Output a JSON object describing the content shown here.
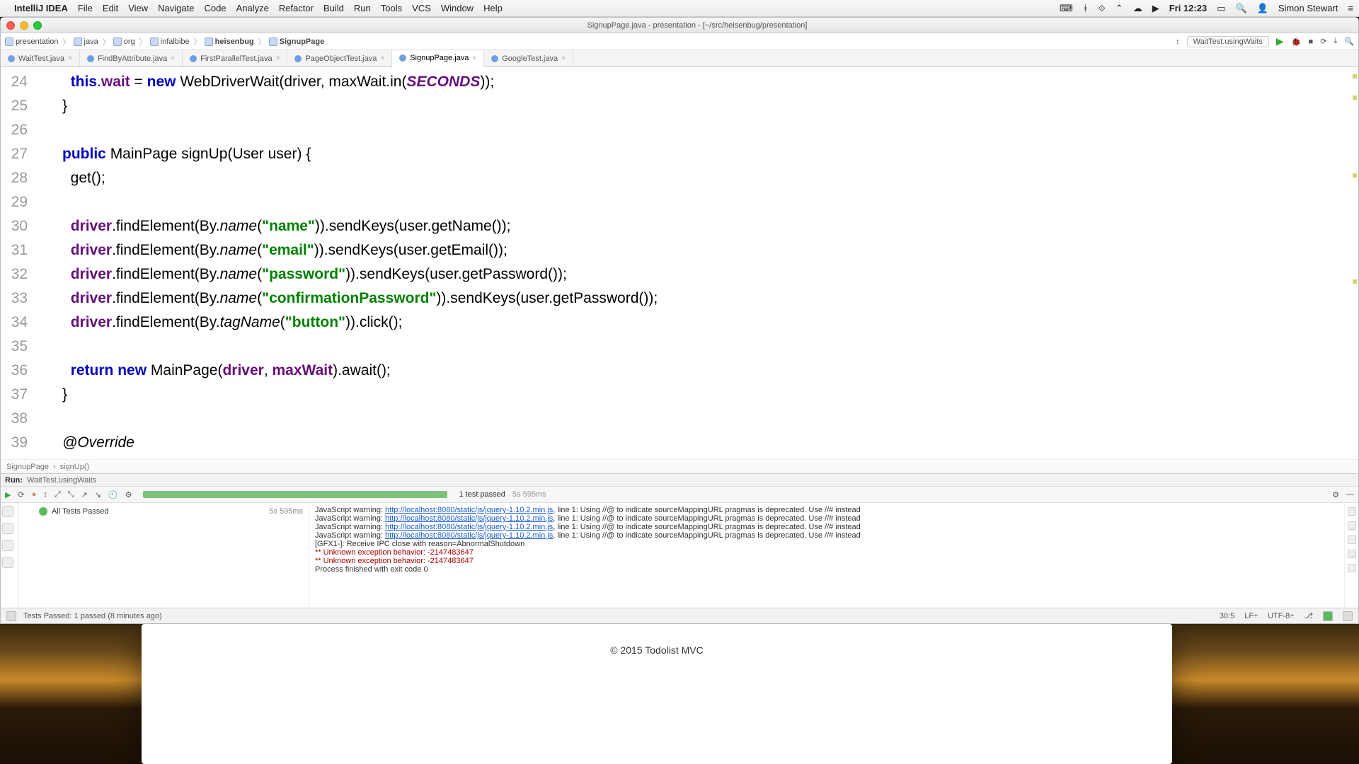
{
  "menubar": {
    "app": "IntelliJ IDEA",
    "items": [
      "File",
      "Edit",
      "View",
      "Navigate",
      "Code",
      "Analyze",
      "Refactor",
      "Build",
      "Run",
      "Tools",
      "VCS",
      "Window",
      "Help"
    ],
    "clock": "Fri 12:23",
    "user": "Simon Stewart"
  },
  "titlebar": {
    "title": "SignupPage.java - presentation - [~/src/heisenbug/presentation]"
  },
  "breadcrumbs": [
    "presentation",
    "java",
    "org",
    "infalbibe",
    "heisenbug",
    "SignupPage"
  ],
  "run_config": "WaitTest.usingWaits",
  "tabs": [
    {
      "label": "WaitTest.java",
      "active": false
    },
    {
      "label": "FindByAttribute.java",
      "active": false
    },
    {
      "label": "FirstParallelTest.java",
      "active": false
    },
    {
      "label": "PageObjectTest.java",
      "active": false
    },
    {
      "label": "SignupPage.java",
      "active": true
    },
    {
      "label": "GoogleTest.java",
      "active": false
    }
  ],
  "editor": {
    "first_line_no": 24,
    "lines": [
      {
        "n": 24,
        "indent": 3,
        "tokens": [
          {
            "t": "kw",
            "v": "this"
          },
          {
            "t": "p",
            "v": "."
          },
          {
            "t": "field",
            "v": "wait"
          },
          {
            "t": "p",
            "v": " = "
          },
          {
            "t": "kw",
            "v": "new"
          },
          {
            "t": "p",
            "v": " WebDriverWait("
          },
          {
            "t": "ident",
            "v": "driver"
          },
          {
            "t": "p",
            "v": ", "
          },
          {
            "t": "ident",
            "v": "maxWait"
          },
          {
            "t": "p",
            "v": ".in("
          },
          {
            "t": "const",
            "v": "SECONDS"
          },
          {
            "t": "p",
            "v": "));"
          }
        ]
      },
      {
        "n": 25,
        "indent": 2,
        "tokens": [
          {
            "t": "p",
            "v": "}"
          }
        ]
      },
      {
        "n": 26,
        "indent": 0,
        "tokens": []
      },
      {
        "n": 27,
        "indent": 2,
        "tokens": [
          {
            "t": "kw",
            "v": "public"
          },
          {
            "t": "p",
            "v": " MainPage signUp(User user) {"
          }
        ]
      },
      {
        "n": 28,
        "indent": 3,
        "tokens": [
          {
            "t": "p",
            "v": "get();"
          }
        ]
      },
      {
        "n": 29,
        "indent": 0,
        "tokens": []
      },
      {
        "n": 30,
        "indent": 3,
        "tokens": [
          {
            "t": "field",
            "v": "driver"
          },
          {
            "t": "p",
            "v": ".findElement(By."
          },
          {
            "t": "mname",
            "v": "name"
          },
          {
            "t": "p",
            "v": "("
          },
          {
            "t": "str",
            "v": "\"name\""
          },
          {
            "t": "p",
            "v": ")).sendKeys(user.getName());"
          }
        ]
      },
      {
        "n": 31,
        "indent": 3,
        "tokens": [
          {
            "t": "field",
            "v": "driver"
          },
          {
            "t": "p",
            "v": ".findElement(By."
          },
          {
            "t": "mname",
            "v": "name"
          },
          {
            "t": "p",
            "v": "("
          },
          {
            "t": "str",
            "v": "\"email\""
          },
          {
            "t": "p",
            "v": ")).sendKeys(user.getEmail());"
          }
        ]
      },
      {
        "n": 32,
        "indent": 3,
        "tokens": [
          {
            "t": "field",
            "v": "driver"
          },
          {
            "t": "p",
            "v": ".findElement(By."
          },
          {
            "t": "mname",
            "v": "name"
          },
          {
            "t": "p",
            "v": "("
          },
          {
            "t": "str",
            "v": "\"password\""
          },
          {
            "t": "p",
            "v": ")).sendKeys(user.getPassword());"
          }
        ]
      },
      {
        "n": 33,
        "indent": 3,
        "tokens": [
          {
            "t": "field",
            "v": "driver"
          },
          {
            "t": "p",
            "v": ".findElement(By."
          },
          {
            "t": "mname",
            "v": "name"
          },
          {
            "t": "p",
            "v": "("
          },
          {
            "t": "str",
            "v": "\"confirmationPassword\""
          },
          {
            "t": "p",
            "v": ")).sendKeys(user.getPassword());"
          }
        ]
      },
      {
        "n": 34,
        "indent": 3,
        "tokens": [
          {
            "t": "field",
            "v": "driver"
          },
          {
            "t": "p",
            "v": ".findElement(By."
          },
          {
            "t": "mname",
            "v": "tagName"
          },
          {
            "t": "p",
            "v": "("
          },
          {
            "t": "str",
            "v": "\"button\""
          },
          {
            "t": "p",
            "v": ")).click();"
          }
        ]
      },
      {
        "n": 35,
        "indent": 0,
        "tokens": []
      },
      {
        "n": 36,
        "indent": 3,
        "tokens": [
          {
            "t": "kw",
            "v": "return"
          },
          {
            "t": "p",
            "v": " "
          },
          {
            "t": "kw",
            "v": "new"
          },
          {
            "t": "p",
            "v": " MainPage("
          },
          {
            "t": "field",
            "v": "driver"
          },
          {
            "t": "p",
            "v": ", "
          },
          {
            "t": "field",
            "v": "maxWait"
          },
          {
            "t": "p",
            "v": ").await();"
          }
        ]
      },
      {
        "n": 37,
        "indent": 2,
        "tokens": [
          {
            "t": "p",
            "v": "}"
          }
        ]
      },
      {
        "n": 38,
        "indent": 0,
        "tokens": []
      },
      {
        "n": 39,
        "indent": 2,
        "tokens": [
          {
            "t": "ann",
            "v": "@Override"
          }
        ]
      }
    ],
    "breadcrumb": {
      "class": "SignupPage",
      "method": "signUp()"
    }
  },
  "run": {
    "label_left": "Run:",
    "label_right": "WaitTest.usingWaits",
    "tests_passed_text": "1 test passed",
    "tests_passed_time": "5s 595ms",
    "tree": {
      "root": "All Tests Passed",
      "time": "5s 595ms"
    },
    "console": [
      {
        "pre": "JavaScript warning: ",
        "url": "http://localhost:8080/static/js/jquery-1.10.2.min.js",
        "post": ", line 1: Using //@ to indicate sourceMappingURL pragmas is deprecated. Use //# instead"
      },
      {
        "pre": "JavaScript warning: ",
        "url": "http://localhost:8080/static/js/jquery-1.10.2.min.js",
        "post": ", line 1: Using //@ to indicate sourceMappingURL pragmas is deprecated. Use //# instead"
      },
      {
        "pre": "JavaScript warning: ",
        "url": "http://localhost:8080/static/js/jquery-1.10.2.min.js",
        "post": ", line 1: Using //@ to indicate sourceMappingURL pragmas is deprecated. Use //# instead"
      },
      {
        "pre": "JavaScript warning: ",
        "url": "http://localhost:8080/static/js/jquery-1.10.2.min.js",
        "post": ", line 1: Using //@ to indicate sourceMappingURL pragmas is deprecated. Use //# instead"
      }
    ],
    "console_tail": [
      "[GFX1-]: Receive IPC close with reason=AbnormalShutdown",
      "** Unknown exception behavior: -2147483647",
      "** Unknown exception behavior: -2147483647",
      "",
      "Process finished with exit code 0"
    ]
  },
  "statusbar": {
    "left": "Tests Passed: 1 passed (8 minutes ago)",
    "pos": "30:5",
    "lf": "LF÷",
    "enc": "UTF-8÷"
  },
  "browser_footer": "© 2015 Todolist MVC"
}
